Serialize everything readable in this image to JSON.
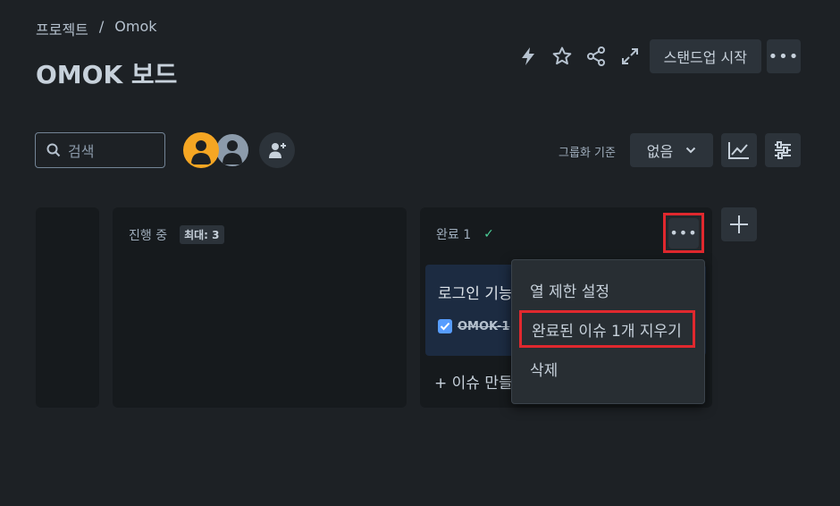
{
  "breadcrumb": {
    "project": "프로젝트",
    "separator": "/",
    "current": "Omok"
  },
  "page": {
    "title": "OMOK 보드"
  },
  "header": {
    "standup_label": "스탠드업 시작"
  },
  "toolbar": {
    "search_placeholder": "검색",
    "group_by_label": "그룹화 기준",
    "group_by_value": "없음"
  },
  "columns": [
    {
      "name": "진행 중",
      "badge": "최대: 3"
    },
    {
      "name": "완료 1"
    }
  ],
  "card": {
    "title": "로그인 기능",
    "key": "OMOK-1"
  },
  "create_issue_label": "+ 이슈 만들기",
  "menu": {
    "items": [
      "열 제한 설정",
      "완료된 이슈 1개 지우기",
      "삭제"
    ]
  },
  "colors": {
    "background": "#1d2125",
    "highlight": "#e0282e",
    "card": "#1c2b41",
    "done_check": "#4bce97"
  }
}
